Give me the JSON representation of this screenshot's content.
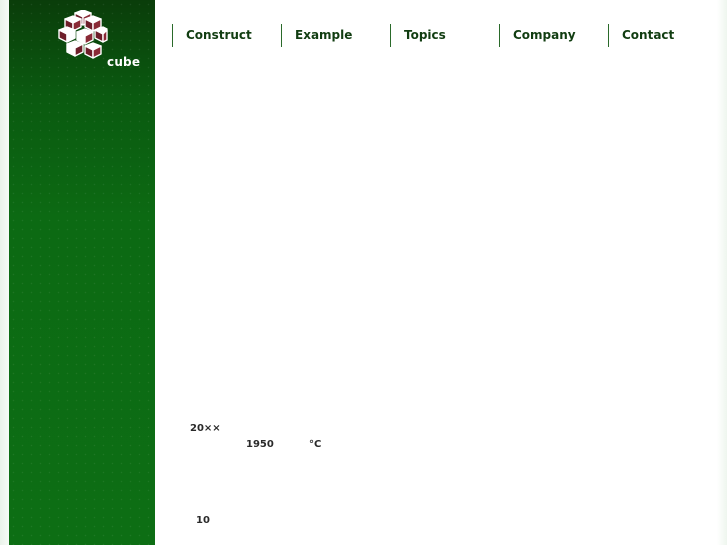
{
  "brand": {
    "logo_text": "cube",
    "colors": {
      "sidebar_green": "#0c6a13",
      "cube_maroon": "#6e1e2a",
      "nav_text": "#113d11"
    }
  },
  "nav": {
    "items": [
      {
        "label": "Construct"
      },
      {
        "label": "Example"
      },
      {
        "label": "Topics"
      },
      {
        "label": "Company"
      },
      {
        "label": "Contact"
      }
    ]
  },
  "content": {
    "year_text": "20××",
    "value_1950": "1950",
    "unit_celsius": "°C",
    "value_10": "10"
  }
}
